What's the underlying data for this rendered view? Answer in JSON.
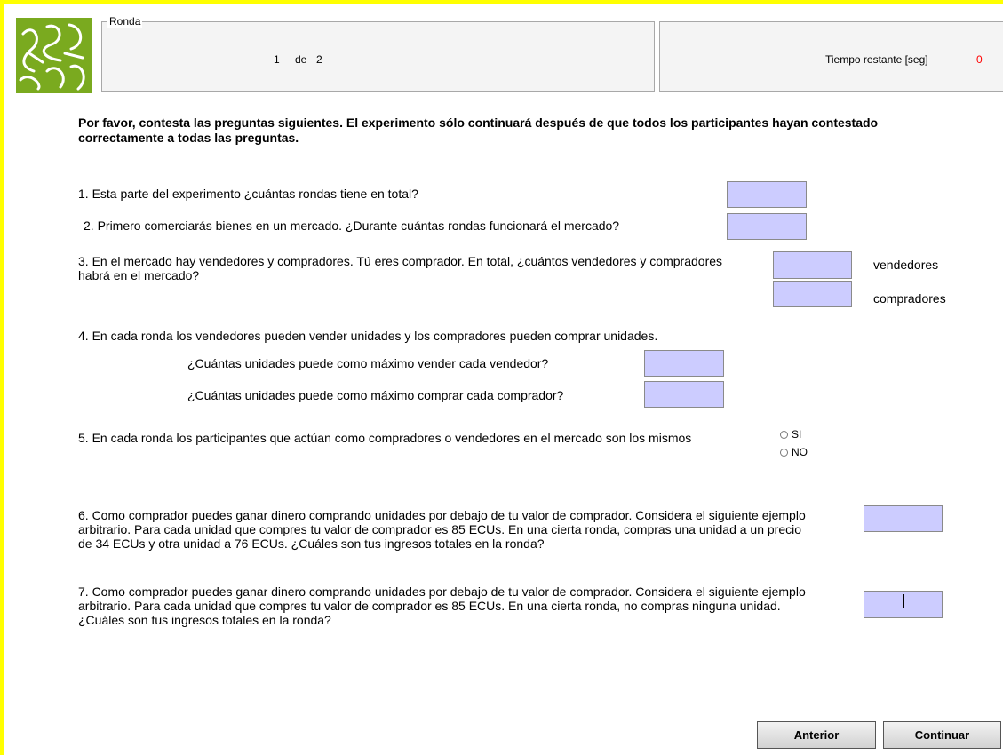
{
  "header": {
    "round_legend": "Ronda",
    "round_current": "1",
    "round_of": "de",
    "round_total": "2",
    "time_label": "Tiempo restante [seg]",
    "time_value": "0",
    "logo_icon": "puzzle-logo-icon"
  },
  "instructions": "Por favor, contesta las preguntas siguientes. El experimento sólo continuará después de que todos los participantes hayan contestado correctamente a todas las preguntas.",
  "questions": {
    "q1": "1. Esta parte del experimento ¿cuántas rondas tiene en total?",
    "q2": "2.  Primero comerciarás bienes en un mercado. ¿Durante cuántas rondas funcionará el mercado?",
    "q3": "3. En el mercado hay vendedores y compradores. Tú eres comprador. En total, ¿cuántos vendedores y compradores habrá en el mercado?",
    "q3_sellers": "vendedores",
    "q3_buyers": "compradores",
    "q4": "4. En cada ronda los vendedores pueden vender unidades y los compradores pueden comprar unidades.",
    "q4a": "¿Cuántas unidades puede como máximo vender cada vendedor?",
    "q4b": "¿Cuántas unidades puede como máximo comprar cada comprador?",
    "q5": "5.  En cada ronda los participantes que actúan como compradores o vendedores en el mercado son los mismos",
    "q5_yes": "SI",
    "q5_no": "NO",
    "q6": "6.  Como comprador puedes ganar dinero comprando unidades por debajo de tu valor de comprador. Considera el siguiente ejemplo arbitrario. Para cada unidad que compres tu valor de comprador es 85 ECUs. En una cierta ronda, compras una unidad a un precio de 34 ECUs y otra unidad a 76 ECUs. ¿Cuáles son tus ingresos totales en la ronda?",
    "q7": "7.  Como comprador puedes ganar dinero comprando unidades por debajo de tu valor de comprador. Considera el siguiente ejemplo arbitrario. Para cada unidad que compres tu valor de comprador es 85 ECUs. En una cierta ronda, no compras ninguna unidad. ¿Cuáles son tus ingresos totales en la ronda?"
  },
  "fields": {
    "q1": "",
    "q2": "",
    "q3_sellers": "",
    "q3_buyers": "",
    "q4a": "",
    "q4b": "",
    "q6": "",
    "q7": ""
  },
  "buttons": {
    "back": "Anterior",
    "continue": "Continuar"
  },
  "colors": {
    "frame": "#ffff00",
    "field": "#ccccff",
    "time_value": "#ff0000",
    "logo": "#7aaa1f"
  }
}
